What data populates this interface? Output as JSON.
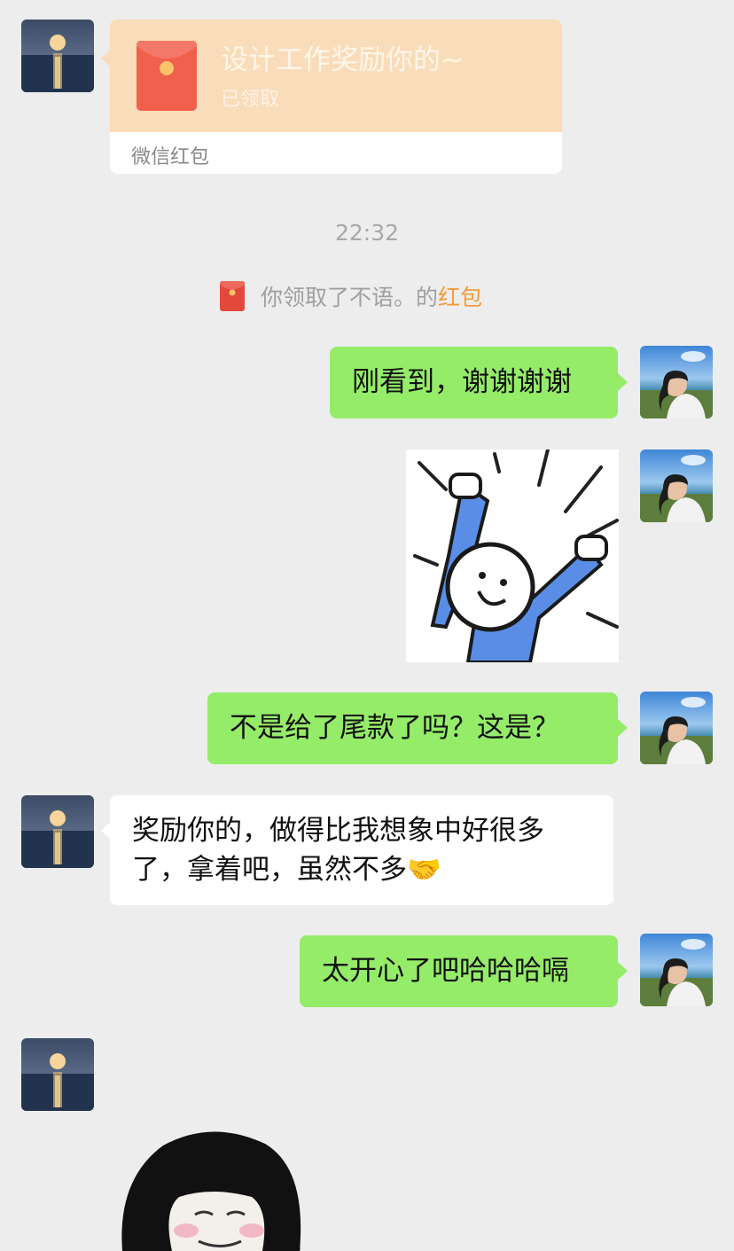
{
  "red_packet": {
    "title": "设计工作奖励你的~",
    "status": "已领取",
    "label": "微信红包",
    "envelope_color": "#f0604c",
    "card_color": "#f9dcb9"
  },
  "timestamp": "22:32",
  "system_notice": {
    "icon": "red-packet-icon",
    "text": "你领取了不语。的",
    "link_text": "红包"
  },
  "messages": [
    {
      "side": "right",
      "type": "text",
      "text": "刚看到，谢谢谢谢"
    },
    {
      "side": "right",
      "type": "sticker",
      "sticker": "cheering-stick-figure-sticker"
    },
    {
      "side": "right",
      "type": "text",
      "text": "不是给了尾款了吗？这是？"
    },
    {
      "side": "left",
      "type": "text",
      "lines": [
        "奖励你的，做得比我想象中好很多",
        "了，拿着吧，虽然不多🤝"
      ]
    },
    {
      "side": "right",
      "type": "text",
      "text": "太开心了吧哈哈哈嗝"
    },
    {
      "side": "left",
      "type": "sticker",
      "sticker": "mushroom-head-face-sticker"
    }
  ],
  "colors": {
    "background": "#ededed",
    "outgoing_bubble": "#95ec69",
    "incoming_bubble": "#ffffff",
    "link": "#f29c3a"
  }
}
